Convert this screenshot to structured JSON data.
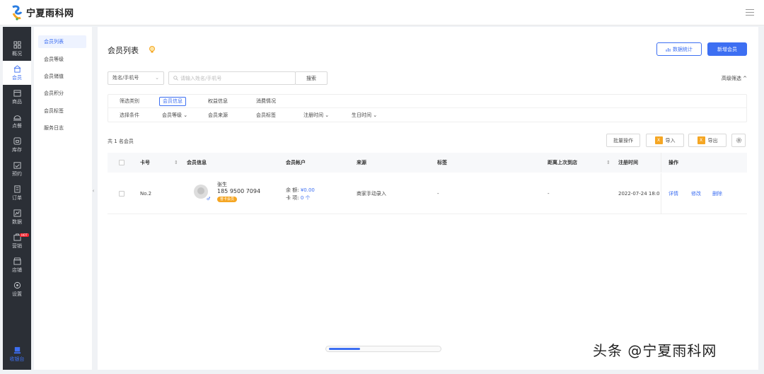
{
  "app": {
    "logo_text": "宁夏雨科网",
    "accent_color": "#3d6ff2"
  },
  "sidebar": {
    "items": [
      {
        "label": "概况",
        "icon": "grid-icon"
      },
      {
        "label": "会员",
        "icon": "member-icon"
      },
      {
        "label": "商品",
        "icon": "goods-icon"
      },
      {
        "label": "点餐",
        "icon": "dining-icon"
      },
      {
        "label": "库存",
        "icon": "inventory-icon"
      },
      {
        "label": "预约",
        "icon": "calendar-icon"
      },
      {
        "label": "订单",
        "icon": "order-icon"
      },
      {
        "label": "数据",
        "icon": "data-icon"
      },
      {
        "label": "营销",
        "icon": "marketing-icon",
        "badge": "HOT"
      },
      {
        "label": "店铺",
        "icon": "store-icon"
      },
      {
        "label": "设置",
        "icon": "settings-icon"
      },
      {
        "label": "收银台",
        "icon": "cashier-icon"
      }
    ],
    "active": "会员"
  },
  "submenu": {
    "items": [
      "会员列表",
      "会员等级",
      "会员储值",
      "会员积分",
      "会员标签",
      "服务日志"
    ],
    "active": "会员列表"
  },
  "header": {
    "title": "会员列表",
    "stats_button": "数据统计",
    "add_button": "新增会员"
  },
  "search": {
    "type_value": "姓名/手机号",
    "placeholder": "请输入姓名/手机号",
    "button": "搜索",
    "advanced": "高级筛选"
  },
  "filters": {
    "row1_label": "筛选类别",
    "row1_options": [
      "会员信息",
      "权益信息",
      "消费情况"
    ],
    "row1_active": "会员信息",
    "row2_label": "选择条件",
    "row2_options": [
      "会员等级",
      "会员来源",
      "会员标签",
      "注册时间",
      "生日时间"
    ]
  },
  "toolbar": {
    "count_text": "共 1 名会员",
    "batch": "批量操作",
    "import": "导入",
    "export": "导出"
  },
  "table": {
    "columns": [
      "卡号",
      "会员信息",
      "会员帐户",
      "来源",
      "标签",
      "距离上次到店",
      "注册时间",
      "操作"
    ],
    "rows": [
      {
        "card_no": "No.2",
        "name": "张生",
        "phone": "185 9500 7094",
        "level_badge": "普卡会员",
        "balance_label": "余 额:",
        "balance_value": "¥0.00",
        "card_label": "卡 项:",
        "card_value": "0 个",
        "source": "商家手动录入",
        "tag": "-",
        "last_visit": "-",
        "register_time": "2022-07-24 18:0",
        "actions": [
          "详情",
          "修改",
          "删除"
        ]
      }
    ]
  },
  "watermark": "头条 @宁夏雨科网"
}
